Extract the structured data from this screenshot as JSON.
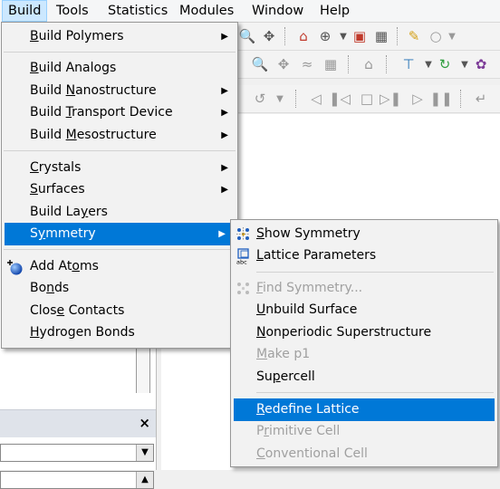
{
  "menubar": {
    "items": [
      "Build",
      "Tools",
      "Statistics",
      "Modules",
      "Window",
      "Help"
    ]
  },
  "build_menu": {
    "items": [
      {
        "pre": "",
        "key": "B",
        "post": "uild Polymers",
        "submenu": true
      },
      {
        "pre": "",
        "key": "B",
        "post": "uild Analogs",
        "submenu": false
      },
      {
        "pre": "Build ",
        "key": "N",
        "post": "anostructure",
        "submenu": true
      },
      {
        "pre": "Build ",
        "key": "T",
        "post": "ransport Device",
        "submenu": true
      },
      {
        "pre": "Build ",
        "key": "M",
        "post": "esostructure",
        "submenu": true
      },
      {
        "pre": "",
        "key": "C",
        "post": "rystals",
        "submenu": true
      },
      {
        "pre": "",
        "key": "S",
        "post": "urfaces",
        "submenu": true
      },
      {
        "pre": "Build La",
        "key": "y",
        "post": "ers",
        "submenu": false
      },
      {
        "pre": "S",
        "key": "y",
        "post": "mmetry",
        "submenu": true
      },
      {
        "pre": "Add At",
        "key": "o",
        "post": "ms",
        "submenu": false
      },
      {
        "pre": "Bo",
        "key": "n",
        "post": "ds",
        "submenu": false
      },
      {
        "pre": "Clos",
        "key": "e",
        "post": " Contacts",
        "submenu": false
      },
      {
        "pre": "",
        "key": "H",
        "post": "ydrogen Bonds",
        "submenu": false
      }
    ]
  },
  "symmetry_menu": {
    "items": [
      {
        "pre": "",
        "key": "S",
        "post": "how Symmetry",
        "disabled": false
      },
      {
        "pre": "",
        "key": "L",
        "post": "attice Parameters",
        "disabled": false
      },
      {
        "pre": "",
        "key": "F",
        "post": "ind Symmetry...",
        "disabled": true
      },
      {
        "pre": "",
        "key": "U",
        "post": "nbuild Surface",
        "disabled": false
      },
      {
        "pre": "",
        "key": "N",
        "post": "onperiodic Superstructure",
        "disabled": false
      },
      {
        "pre": "",
        "key": "M",
        "post": "ake p1",
        "disabled": true
      },
      {
        "pre": "Su",
        "key": "p",
        "post": "ercell",
        "disabled": false
      },
      {
        "pre": "",
        "key": "R",
        "post": "edefine Lattice",
        "disabled": false
      },
      {
        "pre": "P",
        "key": "r",
        "post": "imitive Cell",
        "disabled": true
      },
      {
        "pre": "",
        "key": "C",
        "post": "onventional Cell",
        "disabled": true
      }
    ]
  },
  "panel": {
    "close_glyph": "×"
  },
  "icons": {
    "add_atoms": "blue-ball-icon",
    "show_symmetry": "symmetry-dots-icon",
    "lattice_parameters": "lattice-abc-icon",
    "find_symmetry": "symmetry-dots-icon"
  },
  "colors": {
    "highlight": "#0078d7",
    "disabled_text": "#a0a0a0"
  }
}
